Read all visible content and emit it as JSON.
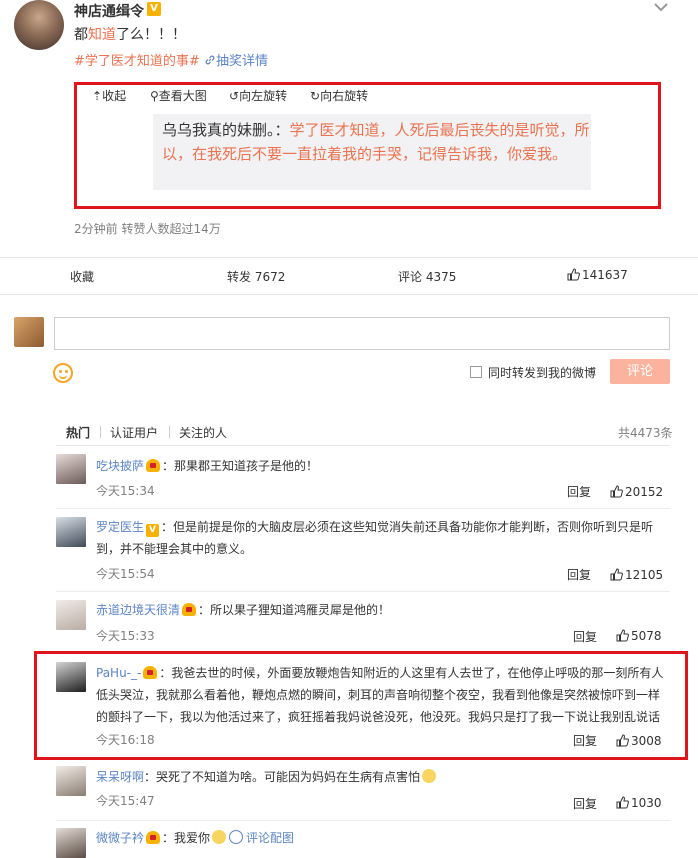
{
  "post": {
    "author": "神店通缉令",
    "text_prefix": "都",
    "text_highlight": "知道",
    "text_suffix": "了么！！！",
    "topic_tag": "#学了医才知道的事#",
    "lottery_link": "抽奖详情",
    "meta": "2分钟前 转赞人数超过14万"
  },
  "image_toolbar": {
    "collapse": "收起",
    "view_large": "查看大图",
    "rotate_left": "向左旋转",
    "rotate_right": "向右旋转"
  },
  "quote": {
    "speaker": "乌乌我真的妹删。：",
    "text": "学了医才知道，人死后最后丧失的是听觉，所以，在我死后不要一直拉着我的手哭，记得告诉我，你爱我。"
  },
  "actions": {
    "favorite": "收藏",
    "repost": "转发 7672",
    "comment": "评论 4375",
    "like": "141637"
  },
  "composer": {
    "input_value": "",
    "also_repost_label": "同时转发到我的微博",
    "submit_label": "评论"
  },
  "comment_tabs": {
    "tabs": [
      "热门",
      "认证用户",
      "关注的人"
    ],
    "total": "共4473条"
  },
  "comments": [
    {
      "user": "吃块披萨",
      "text": "：那果郡王知道孩子是他的！",
      "time": "今天15:34",
      "reply": "回复",
      "likes": "20152"
    },
    {
      "user": "罗定医生",
      "text": "：但是前提是你的大脑皮层必须在这些知觉消失前还具备功能你才能判断，否则你听到只是听到，并不能理会其中的意义。",
      "time": "今天15:54",
      "reply": "回复",
      "likes": "12105"
    },
    {
      "user": "赤道边境天很清",
      "text": "：所以果子狸知道鸿雁灵犀是他的！",
      "time": "今天15:33",
      "reply": "回复",
      "likes": "5078"
    },
    {
      "user": "PaHu-_-",
      "text": "：我爸去世的时候，外面要放鞭炮告知附近的人这里有人去世了，在他停止呼吸的那一刻所有人低头哭泣，我就那么看着他，鞭炮点燃的瞬间，刺耳的声音响彻整个夜空，我看到他像是突然被惊吓到一样的颤抖了一下，我以为他活过来了，疯狂摇着我妈说爸没死，他没死。我妈只是打了我一下说让我别乱说话",
      "time": "今天16:18",
      "reply": "回复",
      "likes": "3008"
    },
    {
      "user": "呆呆呀啊",
      "text": "：哭死了不知道为啥。可能因为妈妈在生病有点害怕",
      "time": "今天15:47",
      "reply": "回复",
      "likes": "1030"
    },
    {
      "user": "微微子衿",
      "text": "：我爱你",
      "pic_link": "评论配图"
    }
  ]
}
